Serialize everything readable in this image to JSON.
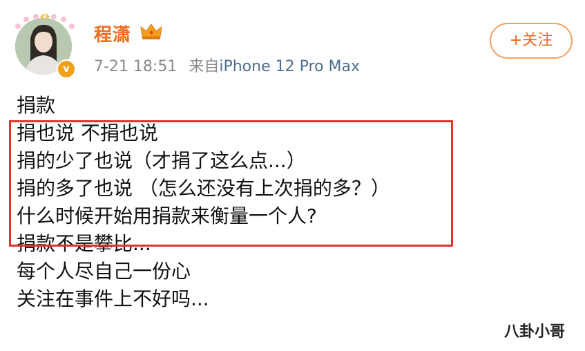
{
  "post": {
    "username": "程潇",
    "verified_badge": "v",
    "date_time": "7-21 18:51",
    "source_prefix": "来自",
    "device": "iPhone 12 Pro Max",
    "follow_label": "+关注",
    "lines": [
      "捐款",
      "捐也说 不捐也说",
      "捐的少了也说（才捐了这么点...）",
      "捐的多了也说 （怎么还没有上次捐的多？）",
      "什么时候开始用捐款来衡量一个人?",
      "捐款不是攀比...",
      "每个人尽自己一份心",
      "关注在事件上不好吗..."
    ],
    "highlighted_lines": [
      1,
      2,
      3,
      4
    ]
  },
  "watermark": "八卦小哥",
  "colors": {
    "username": "#f26b1d",
    "follow_border": "#f2a060",
    "highlight": "#e2312f",
    "device_link": "#4d6e92",
    "meta": "#8a8a8a"
  },
  "icons": [
    "avatar-decoration-icon",
    "crown-icon",
    "verified-icon"
  ]
}
